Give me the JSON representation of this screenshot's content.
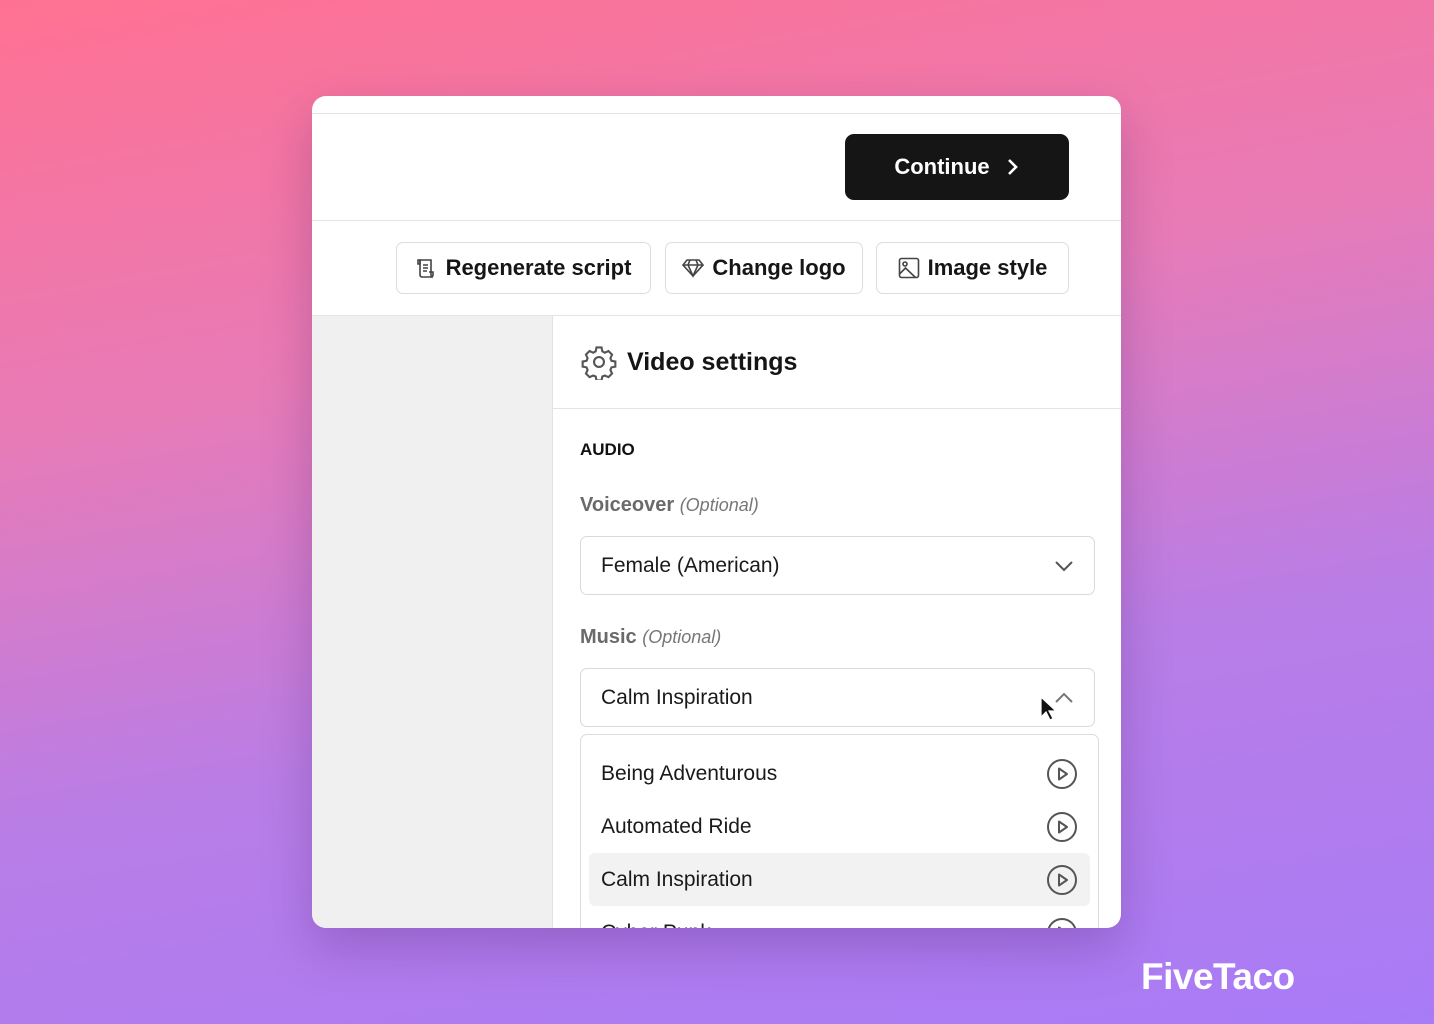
{
  "toolbar": {
    "continue_label": "Continue",
    "regenerate_label": "Regenerate script",
    "change_logo_label": "Change logo",
    "image_style_label": "Image style"
  },
  "settings": {
    "title": "Video settings",
    "section": "AUDIO",
    "voiceover": {
      "label": "Voiceover",
      "optional": "(Optional)",
      "value": "Female (American)"
    },
    "music": {
      "label": "Music",
      "optional": "(Optional)",
      "value": "Calm Inspiration",
      "options": [
        "Being Adventurous",
        "Automated Ride",
        "Calm Inspiration",
        "Cyber Punk"
      ],
      "highlighted": "Calm Inspiration"
    }
  },
  "brand": {
    "logo": "FiveTaco"
  }
}
